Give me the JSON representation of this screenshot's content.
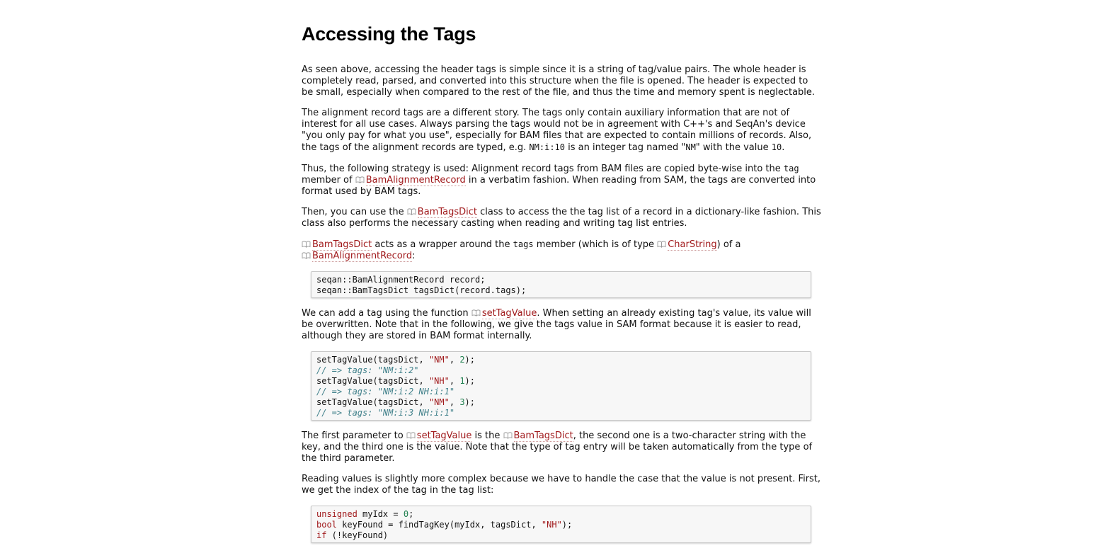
{
  "page": {
    "title": "Accessing the Tags"
  },
  "paragraphs": {
    "p1": "As seen above, accessing the header tags is simple since it is a string of tag/value pairs. The whole header is completely read, parsed, and converted into this structure when the file is opened. The header is expected to be small, especially when compared to the rest of the file, and thus the time and memory spent is neglectable.",
    "p2_a": "The alignment record tags are a different story. The tags only contain auxiliary information that are not of interest for all use cases. Always parsing the tags would not be in agreement with C++'s and SeqAn's device \"you only pay for what you use\", especially for BAM files that are expected to contain millions of records. Also, the tags of the alignment records are typed, e.g. ",
    "p2_code1": "NM:i:10",
    "p2_b": " is an integer tag named \"",
    "p2_code2": "NM",
    "p2_c": "\" with the value ",
    "p2_code3": "10",
    "p2_d": ".",
    "p3_a": "Thus, the following strategy is used: Alignment record tags from BAM files are copied byte-wise into the ",
    "p3_code": "tag",
    "p3_b": " member of ",
    "p3_link": "BamAlignmentRecord",
    "p3_c": " in a verbatim fashion. When reading from SAM, the tags are converted into format used by BAM tags.",
    "p4_a": "Then, you can use the ",
    "p4_link": "BamTagsDict",
    "p4_b": " class to access the the tag list of a record in a dictionary-like fashion. This class also performs the necessary casting when reading and writing tag list entries.",
    "p5_link1": "BamTagsDict",
    "p5_a": " acts as a wrapper around the ",
    "p5_code": "tags",
    "p5_b": " member (which is of type ",
    "p5_link2": "CharString",
    "p5_c": ") of a ",
    "p5_link3": "BamAlignmentRecord",
    "p5_d": ":",
    "p6_a": "We can add a tag using the function ",
    "p6_link": "setTagValue",
    "p6_b": ". When setting an already existing tag's value, its value will be overwritten. Note that in the following, we give the tags value in SAM format because it is easier to read, although they are stored in BAM format internally.",
    "p7_a": "The first parameter to ",
    "p7_link1": "setTagValue",
    "p7_b": " is the ",
    "p7_link2": "BamTagsDict",
    "p7_c": ", the second one is a two-character string with the key, and the third one is the value. Note that the type of tag entry will be taken automatically from the type of the third parameter.",
    "p8": "Reading values is slightly more complex because we have to handle the case that the value is not present. First, we get the index of the tag in the tag list:"
  },
  "code1": {
    "l1_ns": "seqan::",
    "l1_rest": "BamAlignmentRecord record;",
    "l2_ns": "seqan::",
    "l2_rest": "BamTagsDict tagsDict(record.tags);"
  },
  "code2": {
    "l1_a": "setTagValue(tagsDict, ",
    "l1_str": "\"NM\"",
    "l1_b": ", ",
    "l1_num": "2",
    "l1_c": ");",
    "l2_cm": "// => tags: \"NM:i:2\"",
    "l3_a": "setTagValue(tagsDict, ",
    "l3_str": "\"NH\"",
    "l3_b": ", ",
    "l3_num": "1",
    "l3_c": ");",
    "l4_cm": "// => tags: \"NM:i:2 NH:i:1\"",
    "l5_a": "setTagValue(tagsDict, ",
    "l5_str": "\"NM\"",
    "l5_b": ", ",
    "l5_num": "3",
    "l5_c": ");",
    "l6_cm": "// => tags: \"NM:i:3 NH:i:1\""
  },
  "code3": {
    "l1_kw": "unsigned",
    "l1_a": " myIdx = ",
    "l1_num": "0",
    "l1_b": ";",
    "l2_kw": "bool",
    "l2_a": " keyFound = findTagKey(myIdx, tagsDict, ",
    "l2_str": "\"NH\"",
    "l2_b": ");",
    "l3_kw": "if",
    "l3_a": " (!keyFound)"
  },
  "icons": {
    "doc_link": "book-icon"
  },
  "colors": {
    "link": "#a0191b",
    "comment": "#40808a",
    "number": "#208050",
    "code_bg": "#f7f7f7"
  }
}
